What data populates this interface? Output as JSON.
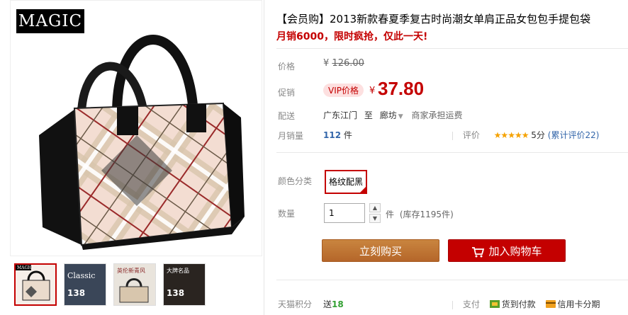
{
  "gallery": {
    "logo_text": "MAGIC",
    "thumbnails": [
      {
        "label": "MAGIC",
        "price": ""
      },
      {
        "label": "Classic",
        "price": "138"
      },
      {
        "label": "英伦新青风",
        "price": ""
      },
      {
        "label": "大牌名品",
        "price": "138"
      }
    ]
  },
  "product": {
    "title": "【会员购】2013新款春夏季复古时尚潮女单肩正品女包包手提包袋",
    "subtitle": "月销6000，限时疯抢，仅此一天!"
  },
  "price": {
    "label": "价格",
    "currency": "¥",
    "original": "126.00"
  },
  "promo": {
    "label": "促销",
    "vip_tag": "VIP价格",
    "currency": "¥",
    "price": "37.80"
  },
  "shipping": {
    "label": "配送",
    "from": "广东江门",
    "to_word": "至",
    "destination": "廊坊",
    "fee": "商家承担运费"
  },
  "sales": {
    "label": "月销量",
    "count": "112",
    "unit": "件",
    "rating_label": "评价",
    "stars": "★★★★★",
    "score": "5分",
    "reviews": "(累计评价22)"
  },
  "color": {
    "label": "颜色分类",
    "selected": "格纹配黑"
  },
  "quantity": {
    "label": "数量",
    "value": "1",
    "unit": "件",
    "stock": "(库存1195件)"
  },
  "actions": {
    "buy_now": "立刻购买",
    "add_cart": "加入购物车"
  },
  "footer": {
    "points_label": "天猫积分",
    "points_prefix": "送",
    "points_value": "18",
    "pay_label": "支付",
    "pay_cod": "货到付款",
    "pay_card": "信用卡分期"
  },
  "colors": {
    "accent": "#c40000",
    "buy_button": "#c07535",
    "link": "#3366aa"
  }
}
